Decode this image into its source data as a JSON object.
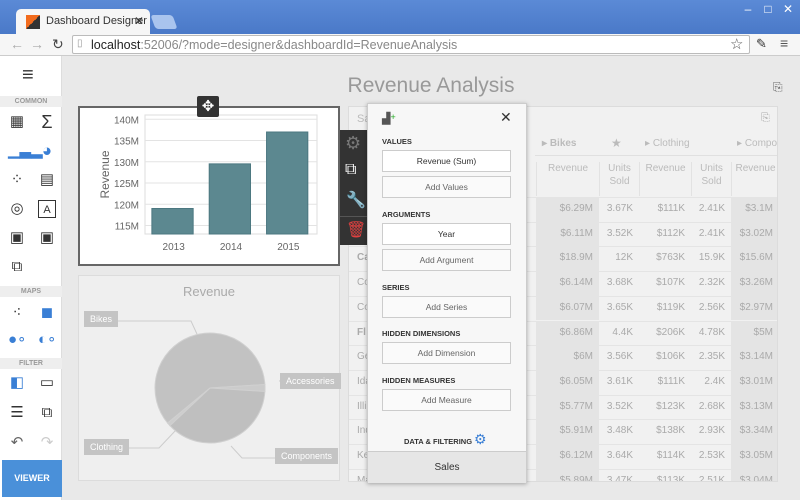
{
  "browser": {
    "tab_title": "Dashboard Designer - ASP",
    "url_host": "localhost",
    "url_rest": ":52006/?mode=designer&dashboardId=RevenueAnalysis"
  },
  "sidebar": {
    "sections": [
      "COMMON",
      "MAPS",
      "FILTER"
    ],
    "viewer_label": "VIEWER"
  },
  "dashboard": {
    "title": "Revenue Analysis"
  },
  "chart_data": [
    {
      "type": "bar",
      "categories": [
        "2013",
        "2014",
        "2015"
      ],
      "values": [
        119,
        129.5,
        137
      ],
      "ylabel": "Revenue",
      "yticks": [
        "115M",
        "120M",
        "125M",
        "130M",
        "135M",
        "140M"
      ],
      "ylim": [
        113,
        141
      ],
      "unit": "M",
      "color": "#5c8890",
      "grid": true
    },
    {
      "type": "pie",
      "title": "Revenue",
      "categories": [
        "Bikes",
        "Accessories",
        "Components",
        "Clothing"
      ],
      "values": [
        60,
        2,
        37,
        1
      ]
    }
  ],
  "popup": {
    "values_label": "VALUES",
    "values_item": "Revenue (Sum)",
    "add_values": "Add Values",
    "arguments_label": "ARGUMENTS",
    "arguments_item": "Year",
    "add_argument": "Add Argument",
    "series_label": "SERIES",
    "add_series": "Add Series",
    "hidden_dimensions_label": "HIDDEN DIMENSIONS",
    "add_dimension": "Add Dimension",
    "hidden_measures_label": "HIDDEN MEASURES",
    "add_measure": "Add Measure",
    "data_filtering_label": "DATA & FILTERING",
    "data_source": "Sales"
  },
  "grid": {
    "title": "Sa",
    "groups": [
      "Bikes",
      "Clothing",
      "Compone"
    ],
    "subheaders": [
      "Revenue",
      "Units Sold",
      "Revenue",
      "Units Sold",
      "Revenue"
    ],
    "rows": [
      {
        "name": "",
        "cells": [
          "$6.29M",
          "3.67K",
          "$111K",
          "2.41K",
          "$3.1M"
        ]
      },
      {
        "name": "",
        "cells": [
          "$6.11M",
          "3.52K",
          "$112K",
          "2.41K",
          "$3.02M"
        ]
      },
      {
        "name": "Ca",
        "cells": [
          "$18.9M",
          "12K",
          "$763K",
          "15.9K",
          "$15.6M"
        ]
      },
      {
        "name": "Co",
        "cells": [
          "$6.14M",
          "3.68K",
          "$107K",
          "2.32K",
          "$3.26M"
        ]
      },
      {
        "name": "Co",
        "cells": [
          "$6.07M",
          "3.65K",
          "$119K",
          "2.56K",
          "$2.97M"
        ]
      },
      {
        "name": "Fl",
        "cells": [
          "$6.86M",
          "4.4K",
          "$206K",
          "4.78K",
          "$5M"
        ]
      },
      {
        "name": "Ge",
        "cells": [
          "$6M",
          "3.56K",
          "$106K",
          "2.35K",
          "$3.14M"
        ]
      },
      {
        "name": "Ida",
        "cells": [
          "$6.05M",
          "3.61K",
          "$111K",
          "2.4K",
          "$3.01M"
        ]
      },
      {
        "name": "Illi",
        "cells": [
          "$5.77M",
          "3.52K",
          "$123K",
          "2.68K",
          "$3.13M"
        ]
      },
      {
        "name": "Ind",
        "cells": [
          "$5.91M",
          "3.48K",
          "$138K",
          "2.93K",
          "$3.34M"
        ]
      },
      {
        "name": "Ke",
        "cells": [
          "$6.12M",
          "3.64K",
          "$114K",
          "2.53K",
          "$3.05M"
        ]
      },
      {
        "name": "Ma",
        "cells": [
          "$5.89M",
          "3.47K",
          "$113K",
          "2.51K",
          "$3.04M"
        ]
      }
    ]
  }
}
